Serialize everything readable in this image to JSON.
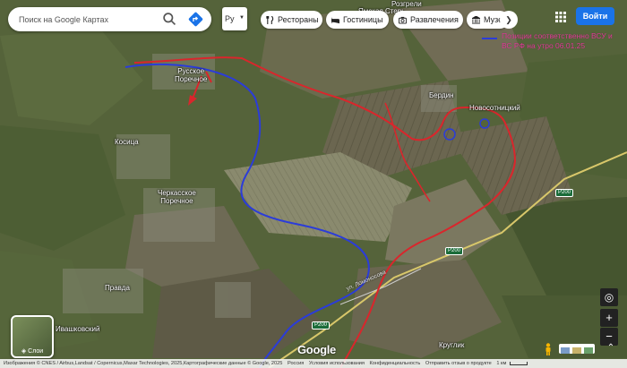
{
  "search": {
    "placeholder": "Поиск на Google Картах"
  },
  "language": {
    "value": "Ру"
  },
  "chips": [
    {
      "label": "Рестораны",
      "icon": "restaurant-icon"
    },
    {
      "label": "Гостиницы",
      "icon": "hotel-icon"
    },
    {
      "label": "Развлечения",
      "icon": "camera-icon"
    },
    {
      "label": "Музе",
      "icon": "museum-icon"
    }
  ],
  "signin": {
    "label": "Войти"
  },
  "legend": {
    "text": "Позиции соответственно ВСУ и ВС РФ на утро  06.01.25",
    "line_color": "#2b3cd9",
    "text_color": "#e23a99"
  },
  "places": {
    "russkoe": "Русское\nПоречное",
    "kosica": "Косица",
    "cherkasskoe": "Черкасское\nПоречное",
    "pravda": "Правда",
    "ivashkovsky": "Ивашковский",
    "berdin": "Бердин",
    "novosotnitsky": "Новосотницкий",
    "rozgreli": "Розгрели",
    "yamskaya": "Ямская Стерь",
    "kruglik": "Круглик"
  },
  "roads": {
    "p200_a": "P200",
    "p200_b": "P200",
    "p200_c": "P200",
    "road_name": "ул. Ломоносова"
  },
  "layers": {
    "label": "Слои"
  },
  "logo": {
    "text": "Google"
  },
  "lines": {
    "blue": "#2b3cd9",
    "red": "#d9262c"
  },
  "footer": {
    "imagery": "Изображения © CNES / Airbus,Landsat / Copernicus,Maxar Technologies, 2025,Картографические данные © Google, 2025",
    "country": "Россия",
    "terms": "Условия использования",
    "privacy": "Конфиденциальность",
    "feedback": "Отправить отзыв о продукте",
    "scale": "1 км"
  }
}
